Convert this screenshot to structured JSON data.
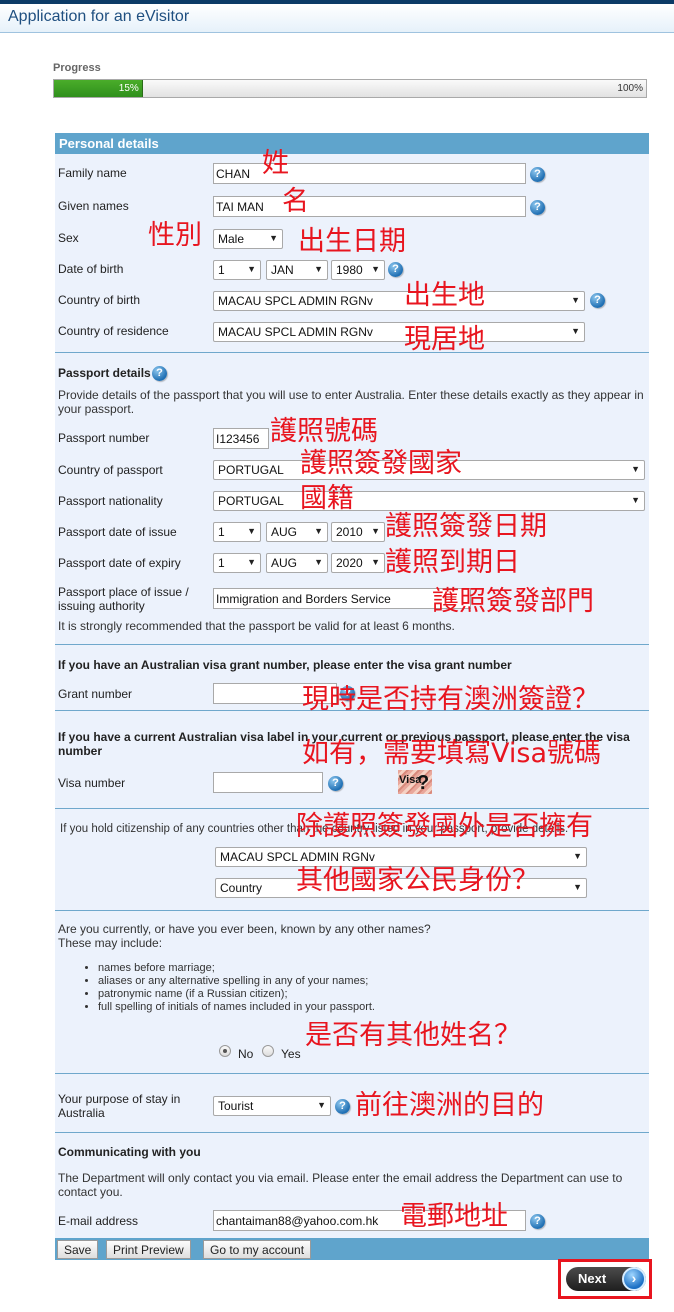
{
  "window": {
    "title": "Application for an eVisitor"
  },
  "progress": {
    "label": "Progress",
    "value_percent": 15,
    "current_text": "15%",
    "max_text": "100%"
  },
  "personal": {
    "header": "Personal details",
    "family_name": {
      "label": "Family name",
      "value": "CHAN"
    },
    "given_names": {
      "label": "Given names",
      "value": "TAI MAN"
    },
    "sex": {
      "label": "Sex",
      "value": "Male"
    },
    "dob": {
      "label": "Date of birth",
      "day": "1",
      "month": "JAN",
      "year": "1980"
    },
    "country_of_birth": {
      "label": "Country of birth",
      "value": "MACAU SPCL ADMIN RGNv"
    },
    "country_of_residence": {
      "label": "Country of residence",
      "value": "MACAU SPCL ADMIN RGNv"
    }
  },
  "passport": {
    "title": "Passport details",
    "intro": "Provide details of the passport that you will use to enter Australia. Enter these details exactly as they appear in your passport.",
    "number": {
      "label": "Passport number",
      "value": "I123456"
    },
    "country": {
      "label": "Country of passport",
      "value": "PORTUGAL"
    },
    "nationality": {
      "label": "Passport nationality",
      "value": "PORTUGAL"
    },
    "issue": {
      "label": "Passport date of issue",
      "day": "1",
      "month": "AUG",
      "year": "2010"
    },
    "expiry": {
      "label": "Passport date of expiry",
      "day": "1",
      "month": "AUG",
      "year": "2020"
    },
    "authority": {
      "label_line1": "Passport place of issue /",
      "label_line2": "issuing authority",
      "value": "Immigration and Borders Service"
    },
    "note": "It is strongly recommended that the passport be valid for at least 6 months."
  },
  "grant": {
    "title": "If you have an Australian visa grant number, please enter the visa grant number",
    "label": "Grant number",
    "value": ""
  },
  "visa_label": {
    "title": "If you have a current Australian visa label in your current or previous passport, please enter the visa number",
    "label": "Visa number",
    "value": "",
    "image_text": "Visa?"
  },
  "citizenship": {
    "text": "If you hold citizenship of any countries other than the country listed in your passport, provide details.",
    "country1": "MACAU SPCL ADMIN RGNv",
    "country2": "Country"
  },
  "other_names": {
    "question": "Are you currently, or have you ever been, known by any other names?",
    "may_include": "These may include:",
    "items": [
      "names before marriage;",
      "aliases or any alternative spelling in any of your names;",
      "patronymic name (if a Russian citizen);",
      "full spelling of initials of names included in your passport."
    ],
    "options": [
      "No",
      "Yes"
    ],
    "selected": "No"
  },
  "purpose": {
    "label_line1": "Your purpose of stay in",
    "label_line2": "Australia",
    "value": "Tourist"
  },
  "communication": {
    "title": "Communicating with you",
    "text": "The Department will only contact you via email. Please enter the email address the Department can use to contact you.",
    "email_label": "E-mail address",
    "email_value": "chantaiman88@yahoo.com.hk"
  },
  "buttons": {
    "save": "Save",
    "print_preview": "Print Preview",
    "account": "Go to my account",
    "next": "Next"
  },
  "annotations": {
    "family": "姓",
    "given": "名",
    "sex": "性別",
    "dob": "出生日期",
    "birthplace": "出生地",
    "residence": "現居地",
    "passport_no": "護照號碼",
    "passport_country": "護照簽發國家",
    "nationality": "國籍",
    "issue_date": "護照簽發日期",
    "expiry_date": "護照到期日",
    "authority": "護照簽發部門",
    "visa_question": "現時是否持有澳洲簽證？",
    "visa_number": "如有，需要填寫Visa號碼",
    "citizenship1": "除護照簽發國外是否擁有",
    "citizenship2": "其他國家公民身份？",
    "other_names": "是否有其他姓名？",
    "purpose": "前往澳洲的目的",
    "email": "電郵地址"
  },
  "colors": {
    "header_blue": "#5fa4cc",
    "panel_bg": "#ecf2fc",
    "progress_green": "#3b9f22",
    "annotation_red": "#e8151f"
  }
}
